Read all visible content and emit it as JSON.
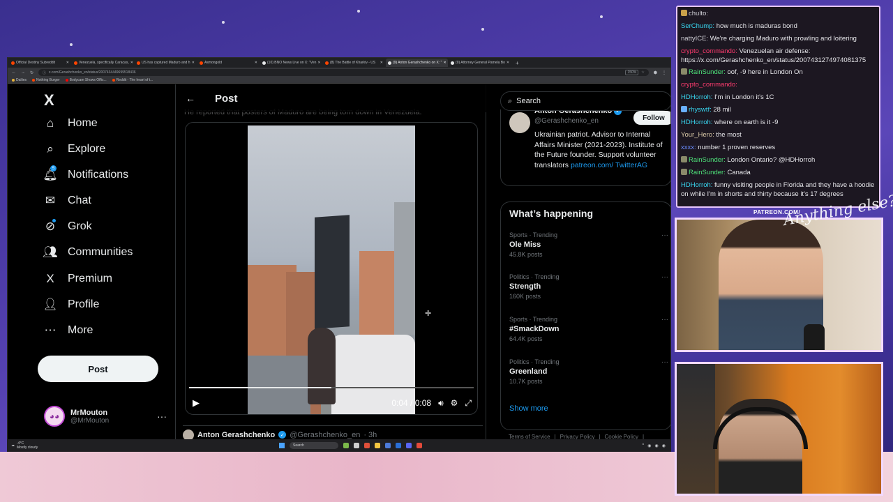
{
  "browser": {
    "tabs": [
      {
        "label": "Official Destiny Subreddit",
        "color": "#ff4500"
      },
      {
        "label": "Venezuela, specifically Caracas,",
        "color": "#ff4500"
      },
      {
        "label": "US has captured Maduro and h",
        "color": "#ff4500"
      },
      {
        "label": "Asmongold",
        "color": "#ff4500"
      },
      {
        "label": "(10) BNO News Live on X: \"Ven",
        "color": "#e7e9ea"
      },
      {
        "label": "(8) The Battle of Kharkiv - US",
        "color": "#ff4500"
      },
      {
        "label": "(9) Anton Gerashchenko on X: \"",
        "color": "#e7e9ea",
        "active": true
      },
      {
        "label": "(9) Attorney General Pamela Bo",
        "color": "#e7e9ea"
      }
    ],
    "address": "x.com/Gerashchenko_en/status/2007434449699518436",
    "zoom": "150%",
    "bookmarks": [
      {
        "label": "Dailies",
        "color": "#e5b23a"
      },
      {
        "label": "Nothing Burger",
        "color": "#ff4500"
      },
      {
        "label": "Bodycam Shows Offic...",
        "color": "#ff0000"
      },
      {
        "label": "Reddit - The heart of t...",
        "color": "#ff4500"
      }
    ]
  },
  "nav": {
    "logo": "X",
    "items": [
      {
        "label": "Home",
        "icon": "⌂"
      },
      {
        "label": "Explore",
        "icon": "⌕"
      },
      {
        "label": "Notifications",
        "icon": "🔔︎"
      },
      {
        "label": "Chat",
        "icon": "✉"
      },
      {
        "label": "Grok",
        "icon": "⊘"
      },
      {
        "label": "Communities",
        "icon": "👥︎"
      },
      {
        "label": "Premium",
        "icon": "X"
      },
      {
        "label": "Profile",
        "icon": "👤︎"
      },
      {
        "label": "More",
        "icon": "⋯"
      }
    ],
    "notification_count": "5",
    "post_button": "Post",
    "account": {
      "name": "MrMouton",
      "handle": "@MrMouton",
      "more": "···"
    }
  },
  "post": {
    "header_title": "Post",
    "cut_text": "He reported that posters of Maduro are being torn down in Venezuela.",
    "video": {
      "time": "0:04 / 0:08",
      "progress": 0.5
    },
    "reply": {
      "name": "Anton Gerashchenko",
      "handle": "@Gerashchenko_en",
      "time": "· 3h"
    }
  },
  "right": {
    "search_placeholder": "Search",
    "profile": {
      "name": "Anton Gerashchenko",
      "handle": "@Gerashchenko_en",
      "follow": "Follow",
      "bio": "Ukrainian patriot. Advisor to Internal Affairs Minister (2021-2023). Institute of the Future founder. Support volunteer translators ",
      "link": "patreon.com/ TwitterAG"
    },
    "whats_happening": "What’s happening",
    "trends": [
      {
        "meta": "Sports · Trending",
        "name": "Ole Miss",
        "count": "45.8K posts"
      },
      {
        "meta": "Politics · Trending",
        "name": "Strength",
        "count": "160K posts"
      },
      {
        "meta": "Sports · Trending",
        "name": "#SmackDown",
        "count": "64.4K posts"
      },
      {
        "meta": "Politics · Trending",
        "name": "Greenland",
        "count": "10.7K posts"
      }
    ],
    "show_more": "Show more",
    "footer": [
      "Terms of Service",
      "Privacy Policy",
      "Cookie Policy"
    ]
  },
  "taskbar": {
    "weather_temp": "-4°C",
    "weather_desc": "Mostly cloudy",
    "search": "Search"
  },
  "chat": {
    "messages": [
      {
        "user": "chulto:",
        "text": "",
        "color": "u-plain",
        "badge": "#c9a14a"
      },
      {
        "user": "SerChump:",
        "text": "how much is maduras bond",
        "color": "u-cyan"
      },
      {
        "user": "nattyICE:",
        "text": "We're charging Maduro with prowling and loitering",
        "color": "u-plain"
      },
      {
        "user": "crypto_commando:",
        "text": "Venezuelan air defense: https://x.com/Gerashchenko_en/status/2007431274974081375",
        "color": "u-pink",
        "wrap": true
      },
      {
        "user": "RainSunder:",
        "text": "oof, -9 here in London On",
        "color": "u-green",
        "badge": "#8a8a6a"
      },
      {
        "user": "crypto_commando:",
        "text": "",
        "color": "u-pink"
      },
      {
        "user": "HDHorroh:",
        "text": "I'm in London it's 1C",
        "color": "u-cyan"
      },
      {
        "user": "rhyswtf:",
        "text": "28 mil",
        "color": "u-cyan",
        "badge": "#6ab0ff"
      },
      {
        "user": "HDHorroh:",
        "text": "where on earth is it -9",
        "color": "u-cyan"
      },
      {
        "user": "Your_Hero:",
        "text": "the most",
        "color": "u-tan"
      },
      {
        "user": "xxxx:",
        "text": "number 1 proven reserves",
        "color": "u-blue"
      },
      {
        "user": "RainSunder:",
        "text": "London Ontario? @HDHorroh",
        "color": "u-green",
        "badge": "#8a8a6a"
      },
      {
        "user": "RainSunder:",
        "text": "Canada",
        "color": "u-green",
        "badge": "#8a8a6a"
      },
      {
        "user": "HDHorroh:",
        "text": "funny visiting people in Florida and they have a hoodie on while I'm in shorts and thirty because it's 17 degrees",
        "color": "u-cyan",
        "wrap": true
      }
    ]
  },
  "overlay": {
    "patreon": "PATREON.COM/",
    "script": "Anything else?"
  }
}
